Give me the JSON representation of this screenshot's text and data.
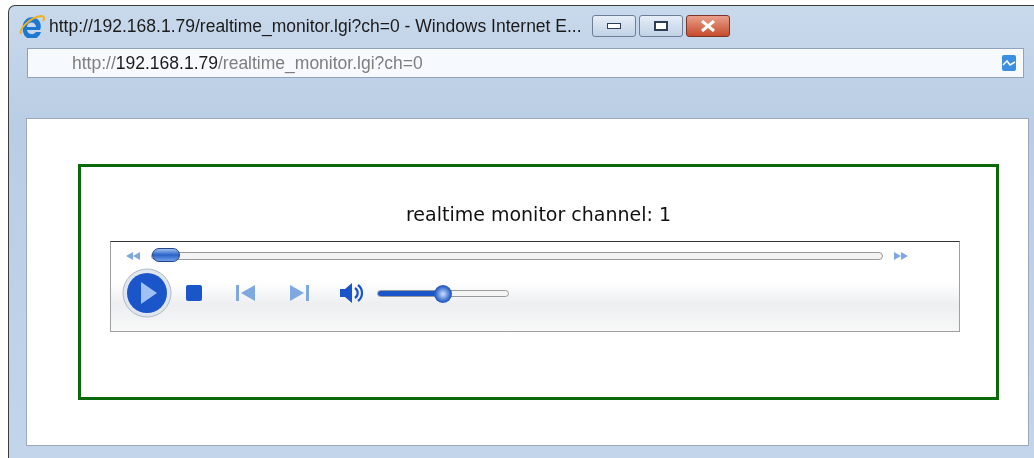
{
  "window": {
    "title": "http://192.168.1.79/realtime_monitor.lgi?ch=0 - Windows Internet E..."
  },
  "address_bar": {
    "scheme": "http://",
    "host": "192.168.1.79",
    "path": "/realtime_monitor.lgi?ch=0"
  },
  "page": {
    "heading": "realtime monitor channel: 1"
  },
  "player": {
    "seek": {
      "level": 0.0
    },
    "volume": {
      "level": 0.5
    }
  }
}
